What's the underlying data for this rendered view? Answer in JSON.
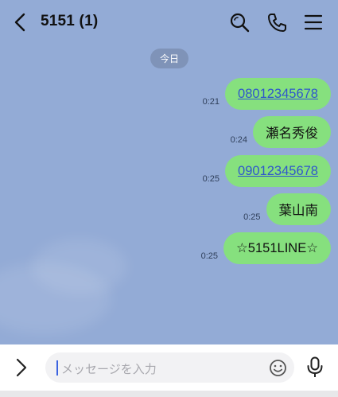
{
  "header": {
    "title": "5151 (1)",
    "icons": [
      "back-chevron-icon",
      "search-icon",
      "phone-icon",
      "menu-icon"
    ]
  },
  "date_label": "今日",
  "messages": [
    {
      "time": "0:21",
      "text": "08012345678",
      "is_link": true
    },
    {
      "time": "0:24",
      "text": "瀬名秀俊",
      "is_link": false
    },
    {
      "time": "0:25",
      "text": "09012345678",
      "is_link": true
    },
    {
      "time": "0:25",
      "text": "葉山南",
      "is_link": false
    },
    {
      "time": "0:25",
      "text": "☆5151LINE☆",
      "is_link": false
    }
  ],
  "input": {
    "placeholder": "メッセージを入力",
    "value": "",
    "icons": [
      "expand-chevron-icon",
      "emoji-icon",
      "microphone-icon"
    ]
  },
  "colors": {
    "chat_background": "#93abd6",
    "bubble": "#86e07e",
    "link": "#2f56cc",
    "date_pill": "#7f93b8"
  }
}
